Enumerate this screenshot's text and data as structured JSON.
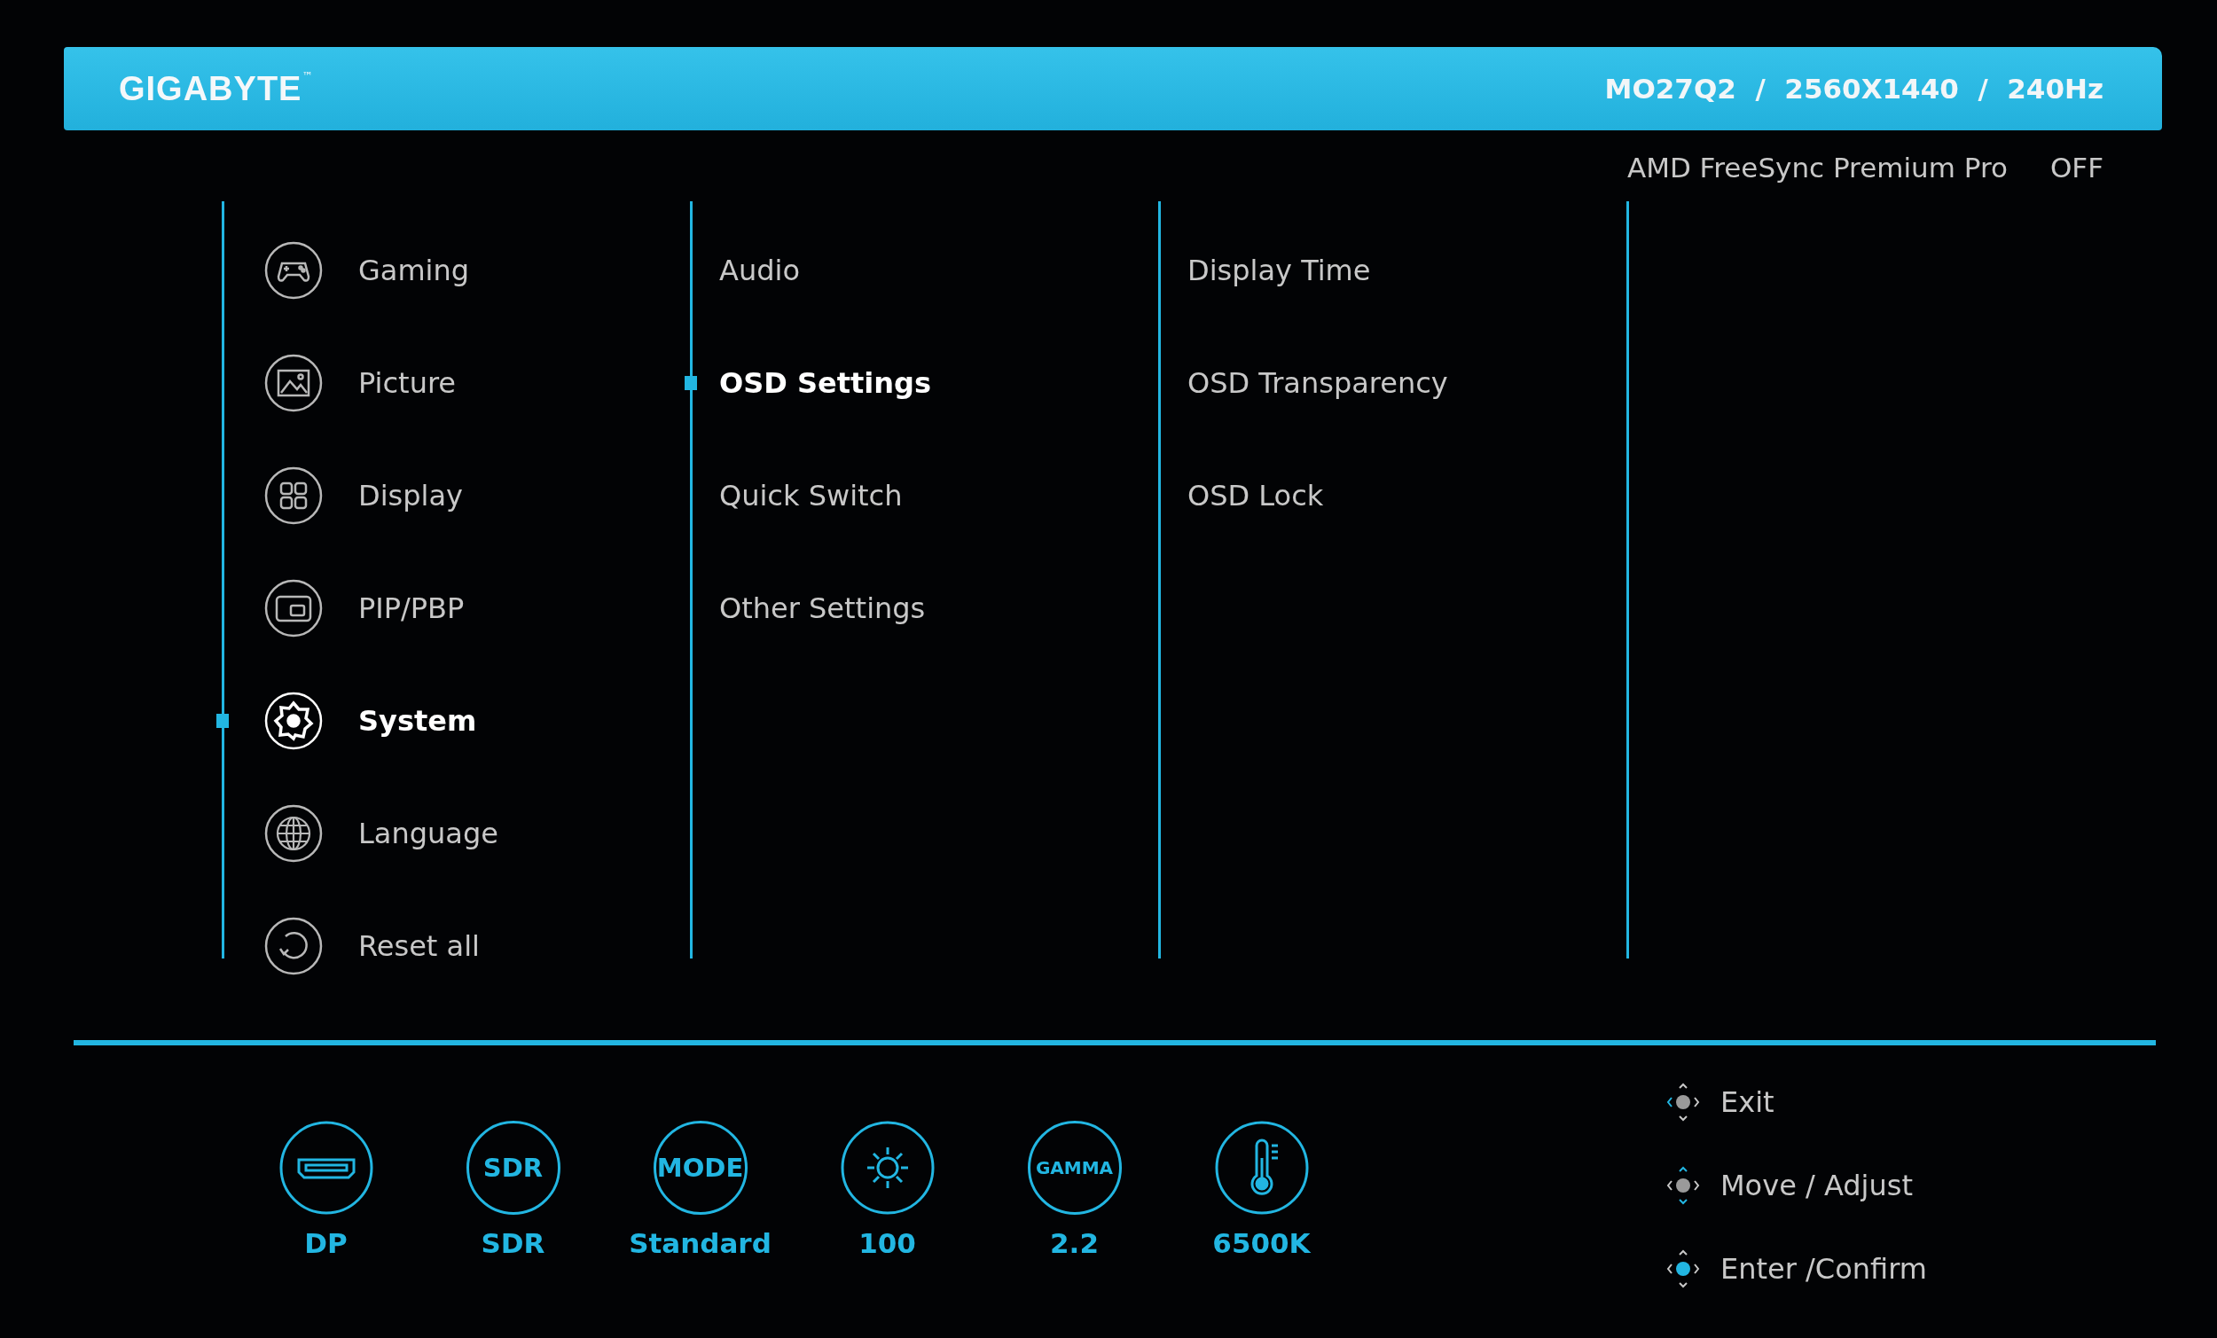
{
  "header": {
    "brand": "GIGABYTE",
    "trademark": "™",
    "model_info": "MO27Q2  /  2560X1440  /  240Hz"
  },
  "freesync": {
    "label": "AMD FreeSync Premium Pro",
    "value": "OFF"
  },
  "main_menu": [
    {
      "kind": "gamepad",
      "label": "Gaming",
      "selected": false
    },
    {
      "kind": "picture",
      "label": "Picture",
      "selected": false
    },
    {
      "kind": "display",
      "label": "Display",
      "selected": false
    },
    {
      "kind": "pip",
      "label": "PIP/PBP",
      "selected": false
    },
    {
      "kind": "system",
      "label": "System",
      "selected": true
    },
    {
      "kind": "language",
      "label": "Language",
      "selected": false
    },
    {
      "kind": "reset",
      "label": "Reset all",
      "selected": false
    }
  ],
  "submenu": [
    {
      "label": "Audio",
      "selected": false
    },
    {
      "label": "OSD Settings",
      "selected": true
    },
    {
      "label": "Quick Switch",
      "selected": false
    },
    {
      "label": "Other Settings",
      "selected": false
    }
  ],
  "options": [
    {
      "label": "Display Time"
    },
    {
      "label": "OSD Transparency"
    },
    {
      "label": "OSD Lock"
    }
  ],
  "status": [
    {
      "kind": "input",
      "value": "DP"
    },
    {
      "kind": "badge",
      "badge": "SDR",
      "value": "SDR"
    },
    {
      "kind": "badge",
      "badge": "MODE",
      "value": "Standard"
    },
    {
      "kind": "brightness",
      "value": "100"
    },
    {
      "kind": "badge",
      "badge": "GAMMA",
      "value": "2.2"
    },
    {
      "kind": "temperature",
      "value": "6500K"
    }
  ],
  "hints": [
    {
      "kind": "exit",
      "label": "Exit"
    },
    {
      "kind": "move",
      "label": "Move / Adjust"
    },
    {
      "kind": "enter",
      "label": "Enter /Confirm"
    }
  ]
}
